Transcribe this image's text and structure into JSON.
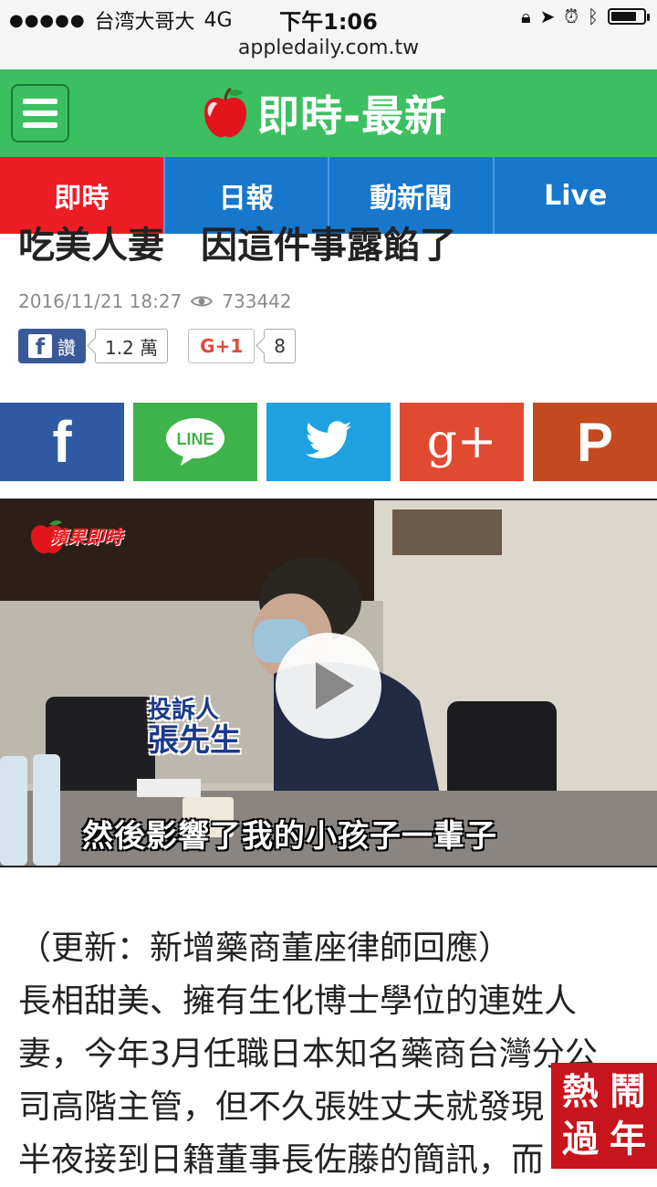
{
  "status_bar": {
    "carrier": "台湾大哥大",
    "network": "4G",
    "time": "下午1:06",
    "url": "appledaily.com.tw"
  },
  "header": {
    "title": "即時-最新",
    "colors": {
      "header_bg": "#3bbf61",
      "tab_active": "#ee1c25",
      "tab_bg": "#1677cc"
    }
  },
  "tabs": [
    {
      "label": "即時"
    },
    {
      "label": "日報"
    },
    {
      "label": "動新聞"
    },
    {
      "label": "Live"
    }
  ],
  "article": {
    "headline_partial": "吃美人妻　因這件事露餡了",
    "date": "2016/11/21 18:27",
    "views": "733442",
    "fb_label": "讚",
    "fb_count": "1.2 萬",
    "gplus_label": "G+1",
    "gplus_count": "8",
    "video": {
      "logo_text": "蘋果即時",
      "speaker_role": "投訴人",
      "speaker_name": "張先生",
      "caption": "然後影響了我的小孩子一輩子"
    },
    "body": [
      "（更新：新增藥商董座律師回應）",
      "長相甜美、擁有生化博士學位的連姓人",
      "妻，今年3月任職日本知名藥商台灣分公",
      "司高階主管，但不久張姓丈夫就發現",
      "半夜接到日籍董事長佐藤的簡訊，而"
    ]
  },
  "share_buttons": [
    {
      "name": "facebook",
      "icon": "facebook-icon",
      "label": "f"
    },
    {
      "name": "line",
      "icon": "line-icon",
      "label": "LINE"
    },
    {
      "name": "twitter",
      "icon": "twitter-icon"
    },
    {
      "name": "googleplus",
      "icon": "google-plus-icon",
      "label": "g+"
    },
    {
      "name": "plurk",
      "icon": "plurk-icon",
      "label": "P"
    }
  ],
  "badge": {
    "text": [
      "熱",
      "鬧",
      "過",
      "年"
    ]
  }
}
